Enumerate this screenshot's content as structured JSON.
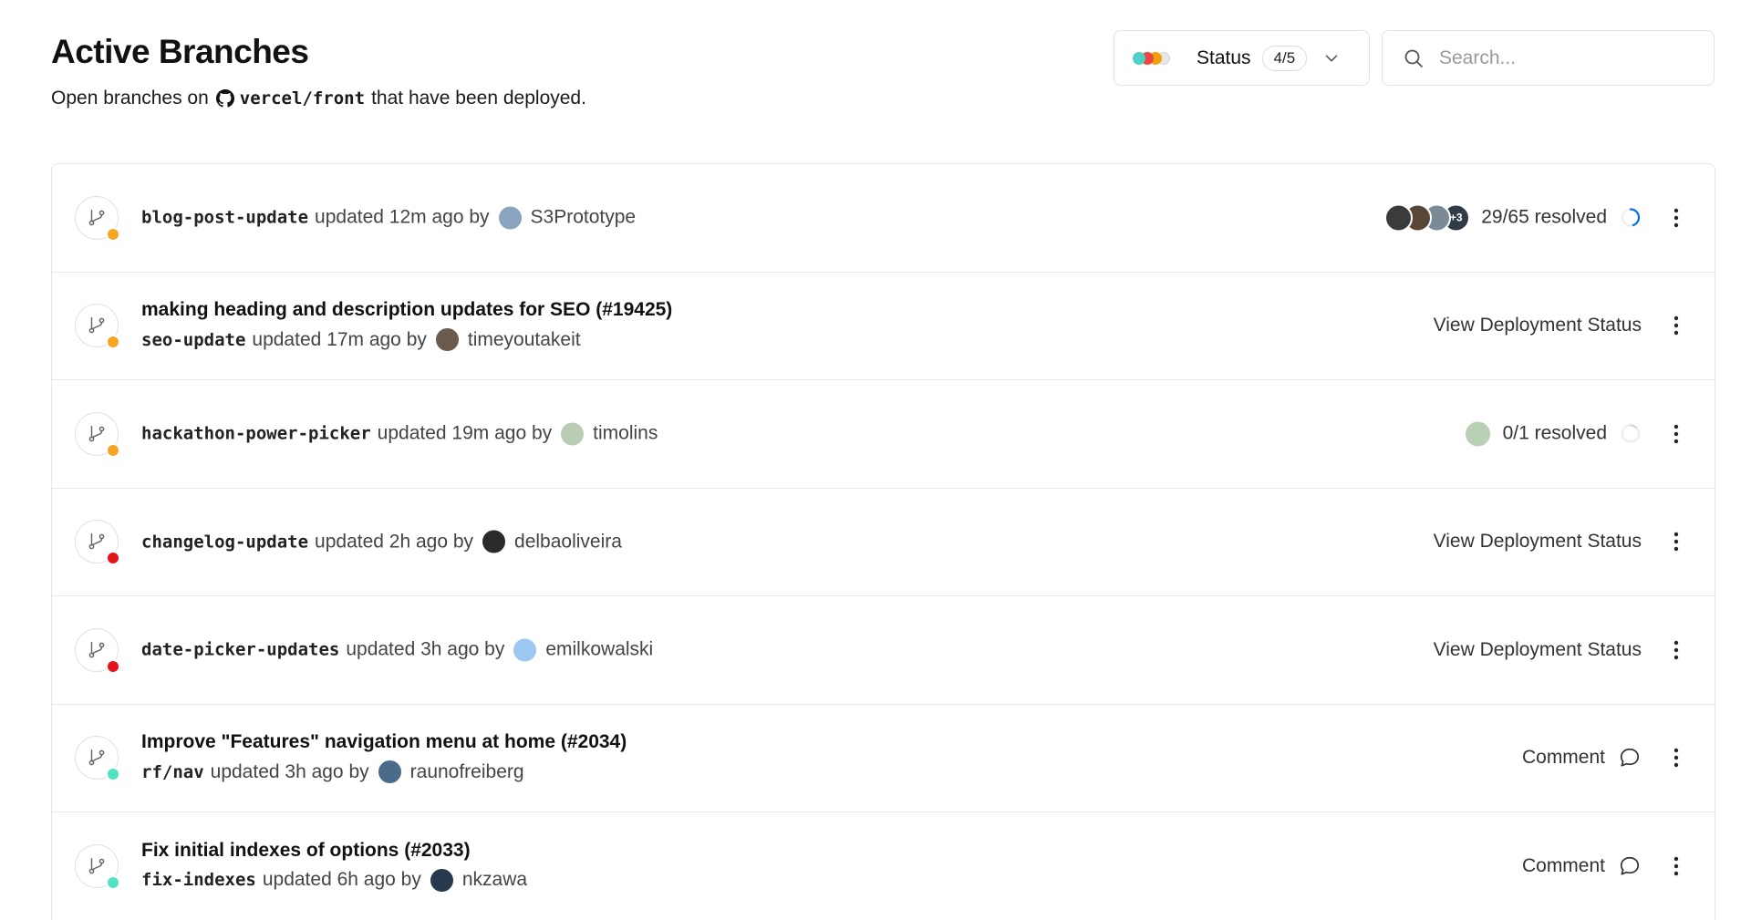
{
  "header": {
    "title": "Active Branches",
    "subtitle_prefix": "Open branches on",
    "repo": "vercel/front",
    "subtitle_suffix": "that have been deployed."
  },
  "filters": {
    "status_label": "Status",
    "status_count": "4/5",
    "status_colors": [
      "#4fd1c5",
      "#ef4444",
      "#f59e0b",
      "#e5e7eb"
    ],
    "search_placeholder": "Search..."
  },
  "branches": [
    {
      "title": "",
      "branch": "blog-post-update",
      "updated_text": "updated 12m ago by",
      "author": "S3Prototype",
      "state_color": "#f5a623",
      "avatar_color": "#8aa4c0",
      "right_type": "resolved",
      "resolved_text": "29/65 resolved",
      "resolved_fraction": 0.446,
      "reviewer_colors": [
        "#3b3b3b",
        "#5a4636",
        "#7a8a96",
        "#2f3b45"
      ],
      "reviewer_overflow": "+3"
    },
    {
      "title": "making heading and description updates for SEO (#19425)",
      "branch": "seo-update",
      "updated_text": "updated 17m ago by",
      "author": "timeyoutakeit",
      "state_color": "#f5a623",
      "avatar_color": "#6b5a4e",
      "right_type": "action",
      "action_label": "View Deployment Status"
    },
    {
      "title": "",
      "branch": "hackathon-power-picker",
      "updated_text": "updated 19m ago by",
      "author": "timolins",
      "state_color": "#f5a623",
      "avatar_color": "#b9cdb4",
      "right_type": "resolved",
      "resolved_text": "0/1 resolved",
      "resolved_fraction": 0,
      "reviewer_colors": [
        "#b8d1b4"
      ],
      "reviewer_overflow": ""
    },
    {
      "title": "",
      "branch": "changelog-update",
      "updated_text": "updated 2h ago by",
      "author": "delbaoliveira",
      "state_color": "#e5141a",
      "avatar_color": "#2a2a2a",
      "right_type": "action",
      "action_label": "View Deployment Status"
    },
    {
      "title": "",
      "branch": "date-picker-updates",
      "updated_text": "updated 3h ago by",
      "author": "emilkowalski",
      "state_color": "#e5141a",
      "avatar_color": "#9cc8f2",
      "right_type": "action",
      "action_label": "View Deployment Status"
    },
    {
      "title": "Improve \"Features\" navigation menu at home (#2034)",
      "branch": "rf/nav",
      "updated_text": "updated 3h ago by",
      "author": "raunofreiberg",
      "state_color": "#50e3c2",
      "avatar_color": "#4a6b8a",
      "right_type": "comment",
      "action_label": "Comment"
    },
    {
      "title": "Fix initial indexes of options (#2033)",
      "branch": "fix-indexes",
      "updated_text": "updated 6h ago by",
      "author": "nkzawa",
      "state_color": "#50e3c2",
      "avatar_color": "#26394d",
      "right_type": "comment",
      "action_label": "Comment"
    }
  ]
}
